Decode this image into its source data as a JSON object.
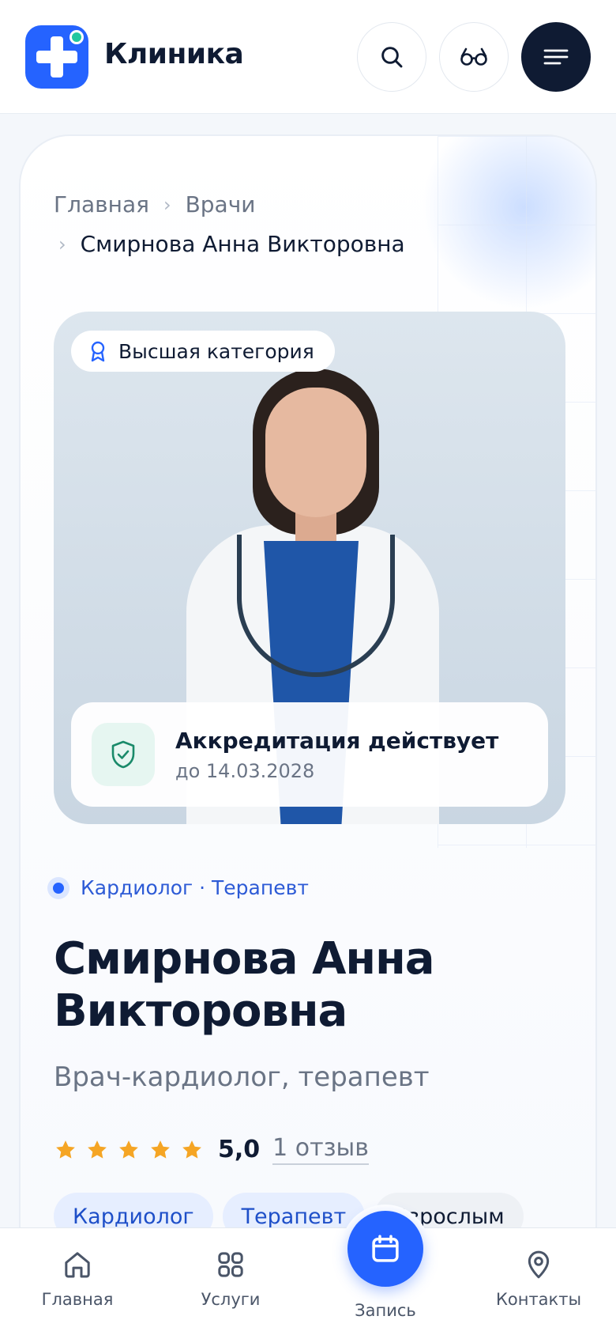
{
  "header": {
    "brand": "Клиника",
    "icons": [
      "search-icon",
      "glasses-icon",
      "menu-icon"
    ]
  },
  "breadcrumb": {
    "home": "Главная",
    "doctors": "Врачи",
    "current": "Смирнова Анна Викторовна"
  },
  "photo": {
    "category_badge": "Высшая категория",
    "accreditation_title": "Аккредитация действует",
    "accreditation_until": "до 14.03.2028"
  },
  "doctor": {
    "specialties": "Кардиолог · Терапевт",
    "name": "Смирнова Анна Викторовна",
    "role": "Врач-кардиолог, терапевт",
    "rating": "5,0",
    "stars": 5,
    "reviews": "1 отзыв",
    "tags": [
      "Кардиолог",
      "Терапевт",
      "Взрослым"
    ]
  },
  "bottom_nav": {
    "home": "Главная",
    "services": "Услуги",
    "booking": "Запись",
    "contacts": "Контакты"
  },
  "colors": {
    "accent": "#2563ff",
    "dark": "#0f1b33",
    "star": "#f5a524",
    "success": "#1a8a6a"
  }
}
